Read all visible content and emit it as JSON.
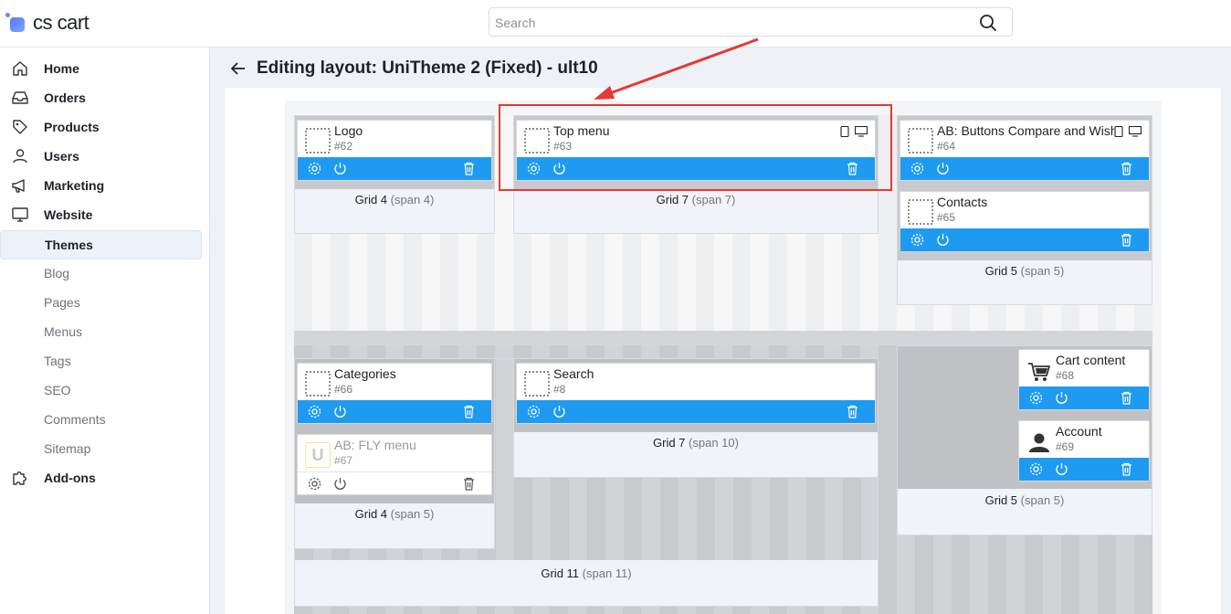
{
  "app": {
    "logo_text": "cs cart"
  },
  "search": {
    "placeholder": "Search"
  },
  "sidebar": {
    "items": [
      {
        "key": "home",
        "label": "Home"
      },
      {
        "key": "orders",
        "label": "Orders"
      },
      {
        "key": "products",
        "label": "Products"
      },
      {
        "key": "users",
        "label": "Users"
      },
      {
        "key": "marketing",
        "label": "Marketing"
      },
      {
        "key": "website",
        "label": "Website"
      },
      {
        "key": "themes",
        "label": "Themes",
        "active": true
      },
      {
        "key": "blog",
        "label": "Blog"
      },
      {
        "key": "pages",
        "label": "Pages"
      },
      {
        "key": "menus",
        "label": "Menus"
      },
      {
        "key": "tags",
        "label": "Tags"
      },
      {
        "key": "seo",
        "label": "SEO"
      },
      {
        "key": "comments",
        "label": "Comments"
      },
      {
        "key": "sitemap",
        "label": "Sitemap"
      },
      {
        "key": "addons",
        "label": "Add-ons"
      }
    ]
  },
  "page": {
    "title": "Editing layout: UniTheme 2 (Fixed) - ult10"
  },
  "grids": {
    "g1": {
      "name": "Grid 4",
      "span": "(span 4)"
    },
    "g2": {
      "name": "Grid 7",
      "span": "(span 7)"
    },
    "g3": {
      "name": "Grid 5",
      "span": "(span 5)"
    },
    "g4": {
      "name": "Grid 4",
      "span": "(span 5)"
    },
    "g5": {
      "name": "Grid 7",
      "span": "(span 10)"
    },
    "g6": {
      "name": "Grid 5",
      "span": "(span 5)"
    },
    "g7": {
      "name": "Grid 11",
      "span": "(span 11)"
    }
  },
  "blocks": {
    "logo": {
      "title": "Logo",
      "id": "#62"
    },
    "top_menu": {
      "title": "Top menu",
      "id": "#63"
    },
    "ab_buttons": {
      "title": "AB: Buttons Compare and Wishlist",
      "id": "#64"
    },
    "contacts": {
      "title": "Contacts",
      "id": "#65"
    },
    "categories": {
      "title": "Categories",
      "id": "#66"
    },
    "fly_menu": {
      "title": "AB: FLY menu",
      "id": "#67",
      "icon_letter": "U"
    },
    "search_block": {
      "title": "Search",
      "id": "#8"
    },
    "cart": {
      "title": "Cart content",
      "id": "#68"
    },
    "account": {
      "title": "Account",
      "id": "#69"
    }
  },
  "colors": {
    "toolbar": "#1e9bf0",
    "highlight": "#e53935",
    "active_nav": "#edf2fa"
  }
}
